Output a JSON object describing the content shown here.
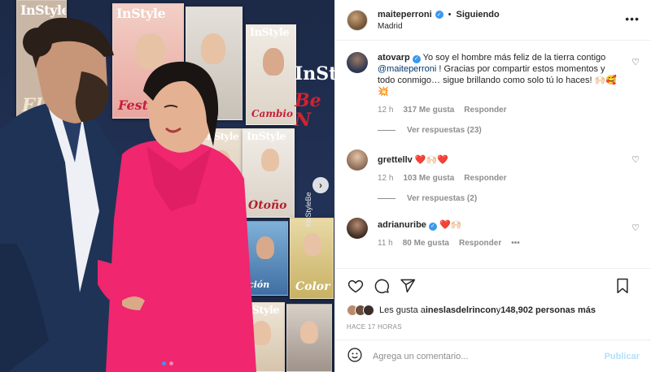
{
  "post": {
    "author": "maiteperroni",
    "follow_status": "Siguiendo",
    "location": "Madrid",
    "separator": "•",
    "more_label": "•••"
  },
  "photo": {
    "banner_logo": "InStyle",
    "banner_red": "Be N",
    "banner_tag": "#InStyleBe",
    "covers": [
      {
        "mast": "InStyle",
        "kick": "El"
      },
      {
        "mast": "InStyle",
        "kick": "Festivo"
      },
      {
        "mast": "InStyle",
        "kick": "Cambio"
      },
      {
        "mast": "InStyle",
        "kick": ""
      },
      {
        "mast": "InStyle",
        "kick": "Otoño"
      },
      {
        "mast": "InStyle",
        "kick": "Color"
      },
      {
        "mast": "InStyle",
        "kick": "ción"
      },
      {
        "mast": "InStyle",
        "kick": ""
      }
    ],
    "next_glyph": "›",
    "slide_count": 2,
    "active_slide": 0
  },
  "comments": [
    {
      "user": "atovarp",
      "verified": true,
      "text_before": " Yo soy el hombre más feliz de la tierra contigo ",
      "mention": "@maiteperroni",
      "text_after": " ! Gracias por compartir estos momentos y todo conmigo… sigue brillando como solo tú lo haces! 🙌🏻🥰💥",
      "time": "12 h",
      "likes": "317 Me gusta",
      "reply": "Responder",
      "replies_label": "Ver respuestas (23)"
    },
    {
      "user": "grettellv",
      "verified": false,
      "text": " ❤️🙌🏻❤️",
      "time": "12 h",
      "likes": "103 Me gusta",
      "reply": "Responder",
      "replies_label": "Ver respuestas (2)"
    },
    {
      "user": "adrianuribe",
      "verified": true,
      "text": " ❤️🙌🏻",
      "time": "11 h",
      "likes": "80 Me gusta",
      "reply": "Responder",
      "more_label": "•••"
    }
  ],
  "likes": {
    "prefix": "Les gusta a ",
    "first_user": "ineslasdelrincon",
    "middle": " y ",
    "others": "148,902 personas más"
  },
  "timestamp": "HACE 17 HORAS",
  "composer": {
    "placeholder": "Agrega un comentario...",
    "post_label": "Publicar"
  },
  "colors": {
    "link": "#00376b",
    "verified": "#3897f0",
    "post_button": "#b2dffc",
    "muted": "#8e8e8e",
    "dress": "#f0266e",
    "suit": "#1f3357"
  }
}
